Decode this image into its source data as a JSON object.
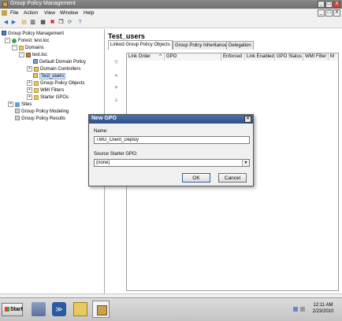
{
  "window": {
    "title": "Group Policy Management",
    "controls": [
      "_",
      "□",
      "X"
    ]
  },
  "menubar": {
    "items": [
      "File",
      "Action",
      "View",
      "Window",
      "Help"
    ],
    "controls": [
      "_",
      "□",
      "X"
    ]
  },
  "toolbar": {
    "icons": [
      "back-icon",
      "forward-icon",
      "up-folder-icon",
      "show-tree-icon",
      "properties-icon",
      "delete-icon",
      "copy-icon",
      "refresh-icon",
      "help-icon"
    ]
  },
  "tree": {
    "root": "Group Policy Management",
    "forest": "Forest: test.loc",
    "domains": "Domains",
    "domain": "test.loc",
    "default_policy": "Default Domain Policy",
    "domain_controllers": "Domain Controllers",
    "selected_ou": "Test_users",
    "gpo_objects": "Group Policy Objects",
    "wmi_filters": "WMI Filters",
    "starter_gpos": "Starter GPOs",
    "sites": "Sites",
    "modeling": "Group Policy Modeling",
    "results": "Group Policy Results"
  },
  "main": {
    "title": "Test_users",
    "tabs": [
      {
        "label": "Linked Group Policy Objects"
      },
      {
        "label": "Group Policy Inheritance"
      },
      {
        "label": "Delegation"
      }
    ],
    "columns": [
      "Link Order",
      "GPO",
      "Enforced",
      "Link Enabled",
      "GPO Status",
      "WMI Filter",
      "M"
    ],
    "sort_indicator": "^"
  },
  "dialog": {
    "title": "New GPO",
    "name_label": "Name:",
    "name_value": "TMG_Client_Deploy",
    "source_label": "Source Starter GPO:",
    "source_value": "(none)",
    "ok": "OK",
    "cancel": "Cancel"
  },
  "taskbar": {
    "start": "Start",
    "time": "12:11 AM",
    "date": "2/23/2010"
  }
}
